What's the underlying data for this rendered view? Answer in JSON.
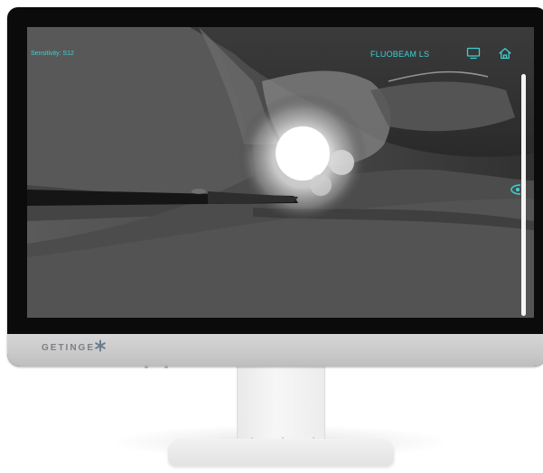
{
  "overlay": {
    "sensitivity_label": "Sensitivity: S12",
    "product_name": "FLUOBEAM LS",
    "accent_color": "#3fd0d4"
  },
  "toolbar": {
    "icons": [
      "monitor-icon",
      "home-icon"
    ]
  },
  "device": {
    "brand": "GETINGE"
  }
}
